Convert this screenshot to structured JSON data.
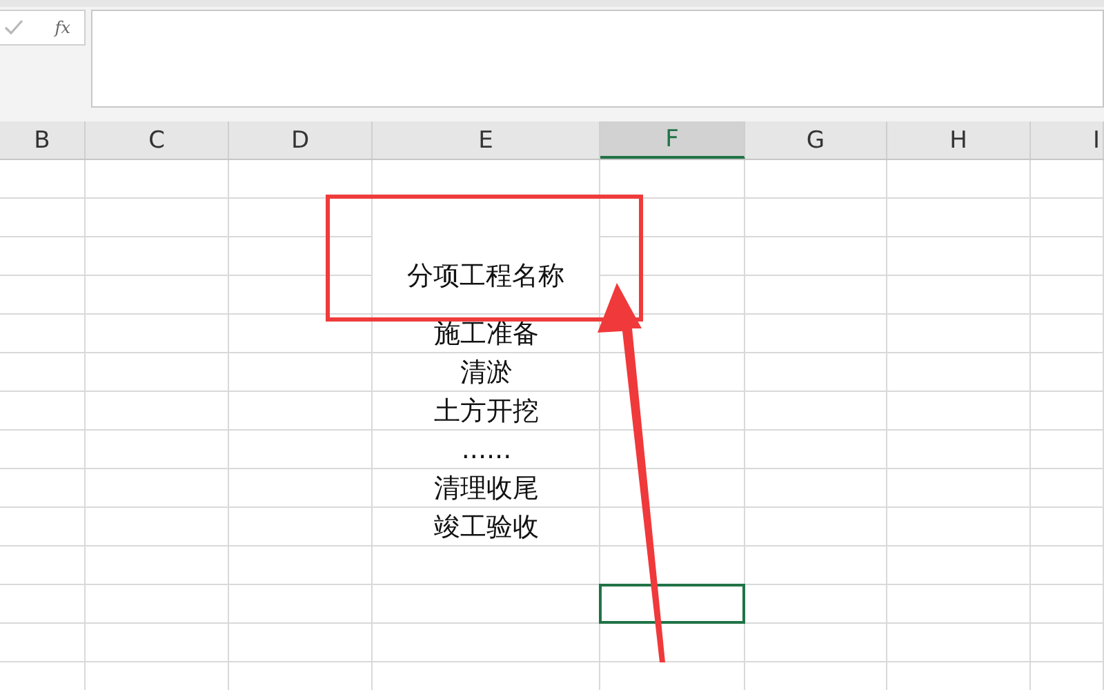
{
  "formula_bar": {
    "function_button": "fx"
  },
  "columns": [
    {
      "label": "B",
      "selected": false
    },
    {
      "label": "C",
      "selected": false
    },
    {
      "label": "D",
      "selected": false
    },
    {
      "label": "E",
      "selected": false
    },
    {
      "label": "F",
      "selected": true
    },
    {
      "label": "G",
      "selected": false
    },
    {
      "label": "H",
      "selected": false
    },
    {
      "label": "I",
      "selected": false
    }
  ],
  "rows": [
    {
      "selected": false
    },
    {
      "selected": false,
      "merged": true,
      "text": "分项工程名称"
    },
    {
      "selected": false,
      "text": "施工准备"
    },
    {
      "selected": false,
      "text": "清淤"
    },
    {
      "selected": false,
      "text": "土方开挖"
    },
    {
      "selected": false,
      "text": "......"
    },
    {
      "selected": false,
      "text": "清理收尾"
    },
    {
      "selected": false,
      "text": "竣工验收"
    },
    {
      "selected": false
    },
    {
      "selected": true
    },
    {
      "selected": false
    },
    {
      "selected": false
    }
  ]
}
